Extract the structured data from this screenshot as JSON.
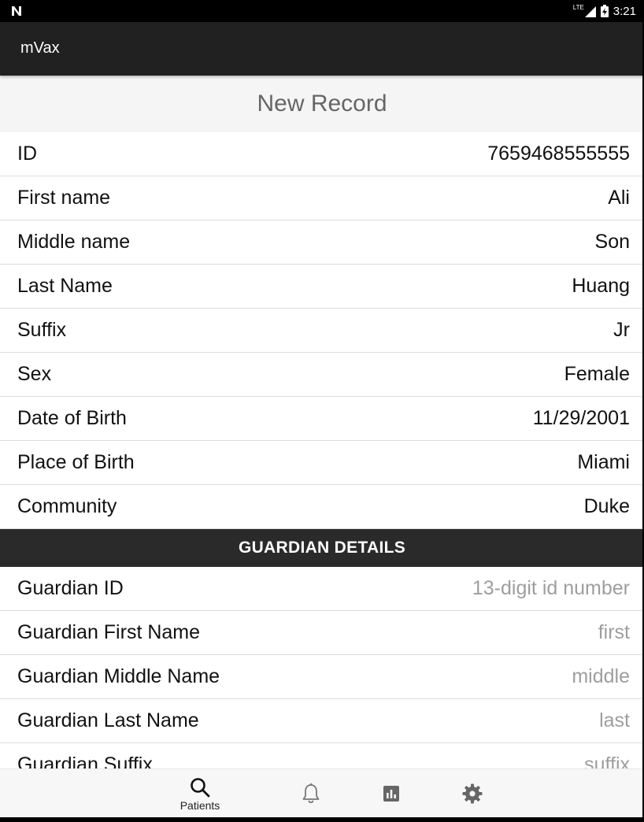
{
  "status_bar": {
    "network": "LTE",
    "time": "3:21"
  },
  "app": {
    "title": "mVax"
  },
  "form": {
    "header": "New Record",
    "rows": [
      {
        "label": "ID",
        "value": "7659468555555"
      },
      {
        "label": "First name",
        "value": "Ali"
      },
      {
        "label": "Middle name",
        "value": "Son"
      },
      {
        "label": "Last Name",
        "value": "Huang"
      },
      {
        "label": "Suffix",
        "value": "Jr"
      },
      {
        "label": "Sex",
        "value": "Female"
      },
      {
        "label": "Date of Birth",
        "value": "11/29/2001"
      },
      {
        "label": "Place of Birth",
        "value": "Miami"
      },
      {
        "label": "Community",
        "value": "Duke"
      }
    ],
    "guardian_section_title": "GUARDIAN DETAILS",
    "guardian_rows": [
      {
        "label": "Guardian ID",
        "placeholder": "13-digit id number"
      },
      {
        "label": "Guardian First Name",
        "placeholder": "first"
      },
      {
        "label": "Guardian Middle Name",
        "placeholder": "middle"
      },
      {
        "label": "Guardian Last Name",
        "placeholder": "last"
      },
      {
        "label": "Guardian Suffix",
        "placeholder": "suffix"
      }
    ]
  },
  "bottom_nav": {
    "items": [
      {
        "label": "Patients",
        "icon": "search-icon",
        "active": true
      },
      {
        "label": "",
        "icon": "bell-icon",
        "active": false
      },
      {
        "label": "",
        "icon": "bar-chart-icon",
        "active": false
      },
      {
        "label": "",
        "icon": "gear-icon",
        "active": false
      }
    ]
  },
  "colors": {
    "app_bar": "#212121",
    "section_header": "#2a2a2a",
    "placeholder_text": "#9e9e9e",
    "header_text": "#666666",
    "icon_gray": "#666666"
  }
}
